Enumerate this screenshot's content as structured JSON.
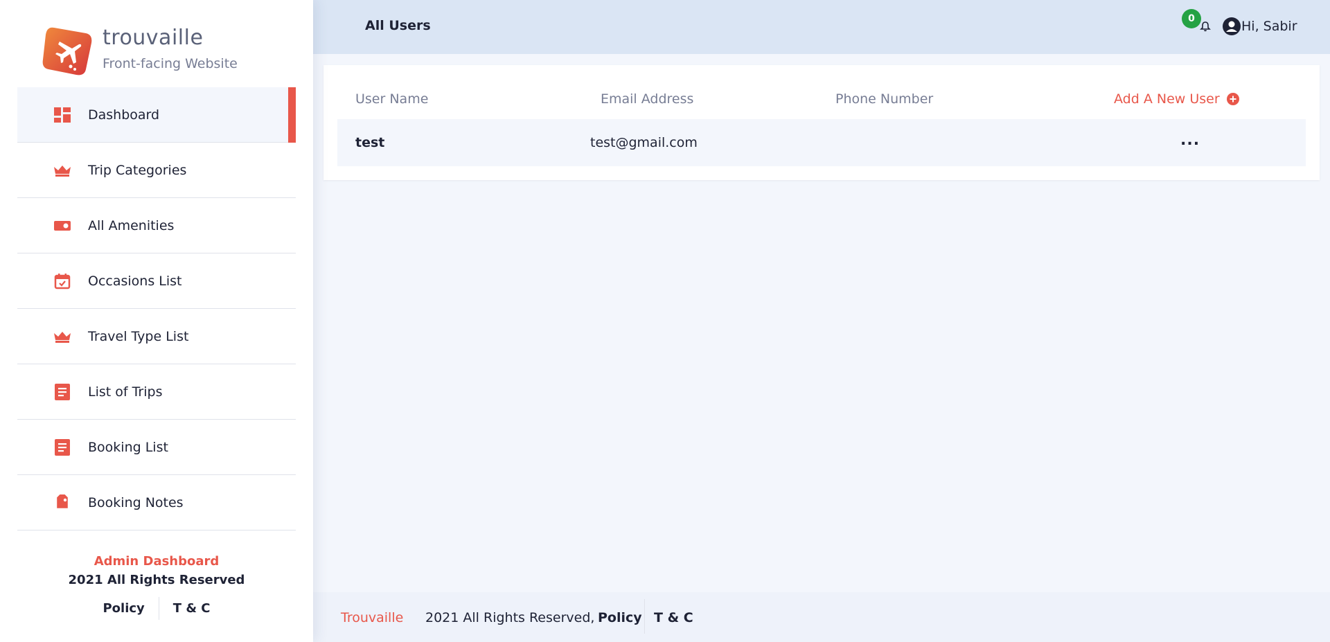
{
  "brand": {
    "name": "trouvaille",
    "subtitle": "Front-facing Website"
  },
  "sidebar": {
    "items": [
      {
        "label": "Dashboard",
        "icon": "dashboard-icon",
        "active": true
      },
      {
        "label": "Trip Categories",
        "icon": "crown-icon"
      },
      {
        "label": "All Amenities",
        "icon": "toggle-icon"
      },
      {
        "label": "Occasions List",
        "icon": "calendar-check-icon"
      },
      {
        "label": "Travel Type List",
        "icon": "crown-icon"
      },
      {
        "label": "List of Trips",
        "icon": "document-icon"
      },
      {
        "label": "Booking List",
        "icon": "document-icon"
      },
      {
        "label": "Booking Notes",
        "icon": "tag-icon"
      }
    ],
    "footer": {
      "title": "Admin Dashboard",
      "rights": "2021 All Rights Reserved",
      "policy": "Policy",
      "terms": "T & C"
    }
  },
  "header": {
    "title": "All Users",
    "notification_count": "0",
    "greeting": "Hi, Sabir"
  },
  "table": {
    "columns": {
      "user_name": "User Name",
      "email": "Email Address",
      "phone": "Phone Number"
    },
    "add_label": "Add A New User",
    "rows": [
      {
        "name": "test",
        "email": "test@gmail.com",
        "phone": "",
        "actions": "..."
      }
    ]
  },
  "footer": {
    "brand": "Trouvaille",
    "rights": "2021 All Rights Reserved,",
    "policy": "Policy",
    "terms": "T & C"
  },
  "colors": {
    "accent": "#e8574a",
    "badge": "#25a244",
    "header_bg": "#dae5f4",
    "page_bg": "#f3f6fc"
  }
}
